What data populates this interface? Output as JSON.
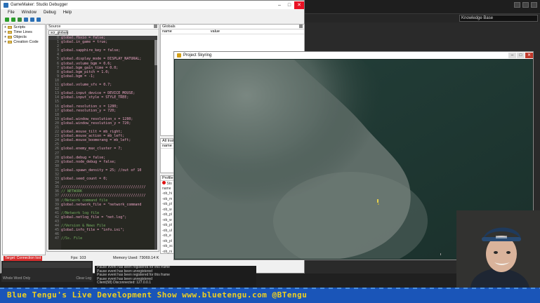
{
  "debugger": {
    "title": "GameMaker: Studio Debugger",
    "menu": [
      "File",
      "Window",
      "Debug",
      "Help"
    ],
    "tree": [
      "Scripts",
      "Time Lines",
      "Objects",
      "Creation Code"
    ],
    "source": {
      "pane_title": "Source",
      "tab": "scr_globals",
      "lines": [
        {
          "n": "0",
          "t": "global.fbxio = false;"
        },
        {
          "n": "1",
          "t": "global.in_game = true;"
        },
        {
          "n": "2",
          "t": ""
        },
        {
          "n": "3",
          "t": "global.sapphire_key = false;"
        },
        {
          "n": "4",
          "t": ""
        },
        {
          "n": "5",
          "t": "global.display_mode = DISPLAY_NATURAL;"
        },
        {
          "n": "6",
          "t": "global.volume_bgm = 0.6;"
        },
        {
          "n": "7",
          "t": "global.bgm_gain_time = 0.0;"
        },
        {
          "n": "8",
          "t": "global.bgm_pitch = 1.0;"
        },
        {
          "n": "9",
          "t": "global.bgm = -1;"
        },
        {
          "n": "10",
          "t": ""
        },
        {
          "n": "11",
          "t": "global.volume_sfx = 0.7;"
        },
        {
          "n": "12",
          "t": ""
        },
        {
          "n": "13",
          "t": "global.input_device = DEVICE_MOUSE;"
        },
        {
          "n": "14",
          "t": "global.input_style = STYLE_TREE;"
        },
        {
          "n": "15",
          "t": ""
        },
        {
          "n": "16",
          "t": "global.resolution_x = 1280;"
        },
        {
          "n": "17",
          "t": "global.resolution_y = 720;"
        },
        {
          "n": "18",
          "t": ""
        },
        {
          "n": "19",
          "t": "global.window_resolution_x = 1280;"
        },
        {
          "n": "20",
          "t": "global.window_resolution_y = 720;"
        },
        {
          "n": "21",
          "t": ""
        },
        {
          "n": "22",
          "t": "global.mouse_tilt = mb_right;"
        },
        {
          "n": "23",
          "t": "global.mouse_action = mb_left;"
        },
        {
          "n": "24",
          "t": "global.mouse_boomerang = mb_left;"
        },
        {
          "n": "25",
          "t": ""
        },
        {
          "n": "26",
          "t": "global.enemy_max_cluster = 7;"
        },
        {
          "n": "27",
          "t": ""
        },
        {
          "n": "28",
          "t": "global.debug = false;"
        },
        {
          "n": "29",
          "t": "global.node_debug = false;"
        },
        {
          "n": "30",
          "t": ""
        },
        {
          "n": "31",
          "t": "global.spawn_density = 25; //out of 10"
        },
        {
          "n": "32",
          "t": ""
        },
        {
          "n": "33",
          "t": "global.seed_count = 0;"
        },
        {
          "n": "34",
          "t": ""
        },
        {
          "n": "35",
          "t": "////////////////////////////////////////"
        },
        {
          "n": "36",
          "t": "// NETWORK",
          "c": true
        },
        {
          "n": "37",
          "t": "////////////////////////////////////////"
        },
        {
          "n": "38",
          "t": "//Network command file",
          "c": true
        },
        {
          "n": "39",
          "t": "global.network_file = \"network_command"
        },
        {
          "n": "40",
          "t": ""
        },
        {
          "n": "41",
          "t": "//Network log file",
          "c": true
        },
        {
          "n": "42",
          "t": "global.netlog_file = \"net.log\";"
        },
        {
          "n": "43",
          "t": ""
        },
        {
          "n": "44",
          "t": "//Version & News File",
          "c": true
        },
        {
          "n": "45",
          "t": "global.info_file = \"info.ini\";"
        },
        {
          "n": "46",
          "t": ""
        },
        {
          "n": "47",
          "t": "//Ss. File",
          "c": true
        }
      ]
    },
    "globals": {
      "pane_title": "Globals",
      "col_name": "name",
      "col_value": "value"
    },
    "all_instances": {
      "pane_title": "All Inst",
      "col_name": "name"
    },
    "profile": {
      "pane_title": "Profile",
      "rec_label": "Sto",
      "col_name": "name",
      "rows": [
        "-ob_hi",
        "-ob_m",
        "-ob_pl",
        "-ob_w",
        "-ob_pl",
        "-ob_w",
        "-ob_pl",
        "-ob_ul",
        "-ob_e",
        "-ob_pl",
        "-ob_sc",
        "-ob_ni"
      ]
    },
    "status": {
      "target": "Target: Connection lost",
      "fps": "Fps: 103",
      "memory": "Memory Used: 73069.14 K"
    }
  },
  "background_app": {
    "knowledge_field": "Knowledge Base"
  },
  "game_window": {
    "title": "Project Skyring"
  },
  "console": {
    "readonly": "Whole Word Only",
    "clear": "Clear Log"
  },
  "log_lines": [
    "Pause event has been registered for this frame",
    "Pause event has been unregistered",
    "Pause event has been registered for this frame",
    "Pause event has been unregistered",
    "Client(58) Disconnected: 127.0.0.1"
  ],
  "banner": {
    "text": "Blue Tengu's Live Development Show   www.bluetengu.com   @BTengu"
  },
  "colors": {
    "banner_bg": "#1a55b8",
    "banner_text": "#f0d020",
    "status_target": "#d62d2d",
    "code_bg": "#272822"
  }
}
